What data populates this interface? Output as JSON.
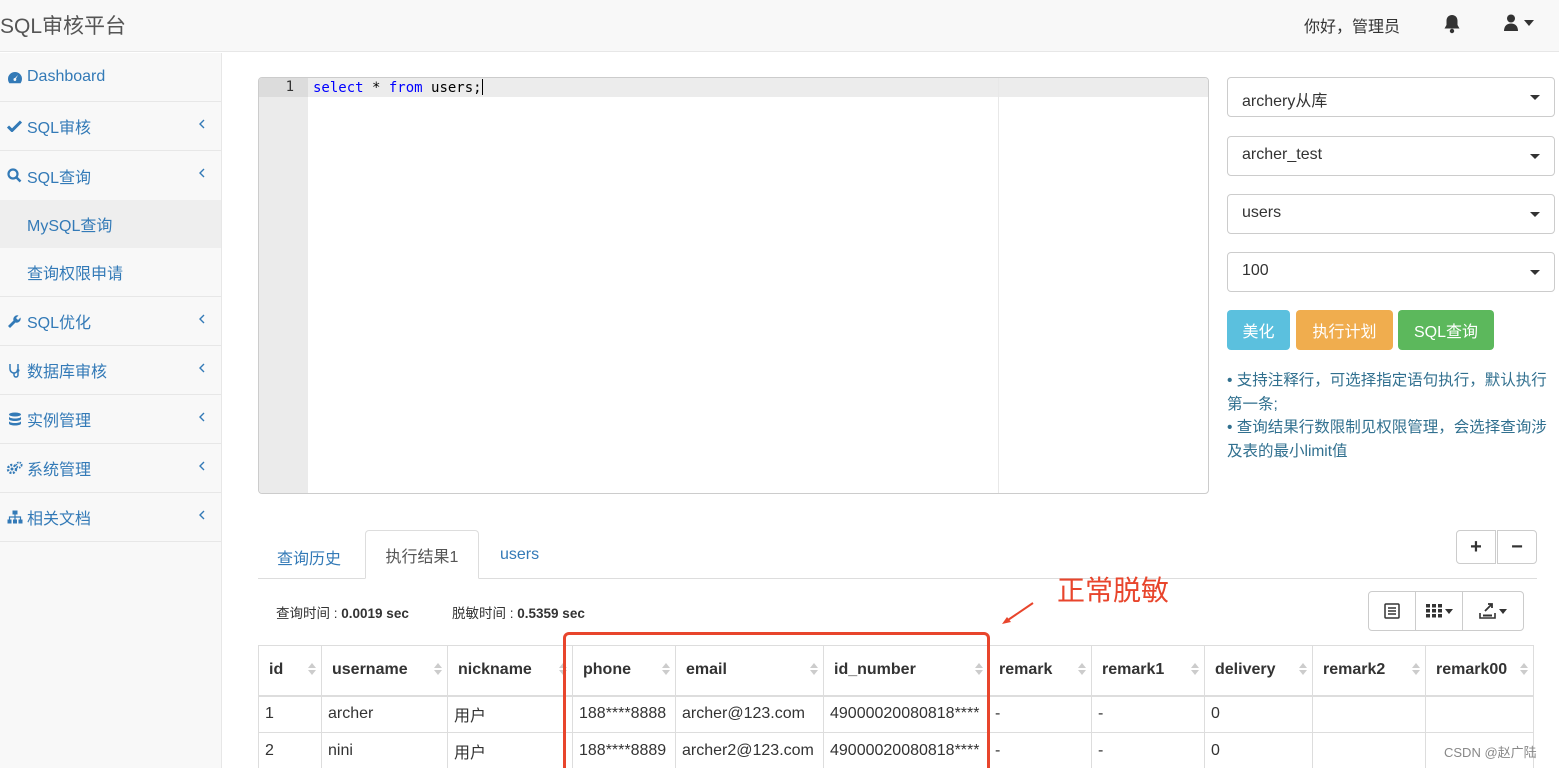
{
  "app": {
    "title": "SQL审核平台",
    "greeting": "你好，管理员"
  },
  "sidebar": {
    "items": [
      {
        "label": "Dashboard",
        "icon": "dashboard-icon"
      },
      {
        "label": "SQL审核",
        "icon": "check-icon"
      },
      {
        "label": "SQL查询",
        "icon": "search-icon"
      },
      {
        "label": "SQL优化",
        "icon": "wrench-icon"
      },
      {
        "label": "数据库审核",
        "icon": "stethoscope-icon"
      },
      {
        "label": "实例管理",
        "icon": "database-icon"
      },
      {
        "label": "系统管理",
        "icon": "cogs-icon"
      },
      {
        "label": "相关文档",
        "icon": "sitemap-icon"
      }
    ],
    "sub_items": [
      {
        "label": "MySQL查询",
        "active": true
      },
      {
        "label": "查询权限申请",
        "active": false
      }
    ]
  },
  "editor": {
    "line_number": "1",
    "kw_select": "select",
    "star": " * ",
    "kw_from": "from",
    "rest": " users;"
  },
  "controls": {
    "instance": "archery从库",
    "database": "archer_test",
    "table": "users",
    "limit": "100",
    "btn_beautify": "美化",
    "btn_explain": "执行计划",
    "btn_query": "SQL查询",
    "btn_colors": {
      "beautify": "#5bc0de",
      "explain": "#f0ad4e",
      "query": "#5cb85c"
    }
  },
  "tips": [
    "•   支持注释行，可选择指定语句执行，默认执行第一条;",
    "•   查询结果行数限制见权限管理，会选择查询涉及表的最小limit值"
  ],
  "tabs": {
    "history": "查询历史",
    "result": "执行结果1",
    "users": "users"
  },
  "stats": {
    "query_label": "查询时间 : ",
    "query_value": "0.0019 sec",
    "mask_label": "脱敏时间 : ",
    "mask_value": "0.5359 sec"
  },
  "annotation": "正常脱敏",
  "table": {
    "columns": [
      "id",
      "username",
      "nickname",
      "phone",
      "email",
      "id_number",
      "remark",
      "remark1",
      "delivery",
      "remark2",
      "remark00"
    ],
    "rows": [
      [
        "1",
        "archer",
        "用户",
        "188****8888",
        "archer@123.com",
        "49000020080818****",
        "-",
        "-",
        "0",
        "",
        ""
      ],
      [
        "2",
        "nini",
        "用户",
        "188****8889",
        "archer2@123.com",
        "49000020080818****",
        "-",
        "-",
        "0",
        "",
        ""
      ]
    ]
  },
  "watermark": "CSDN @赵广陆",
  "accent_color": "#337ab7"
}
